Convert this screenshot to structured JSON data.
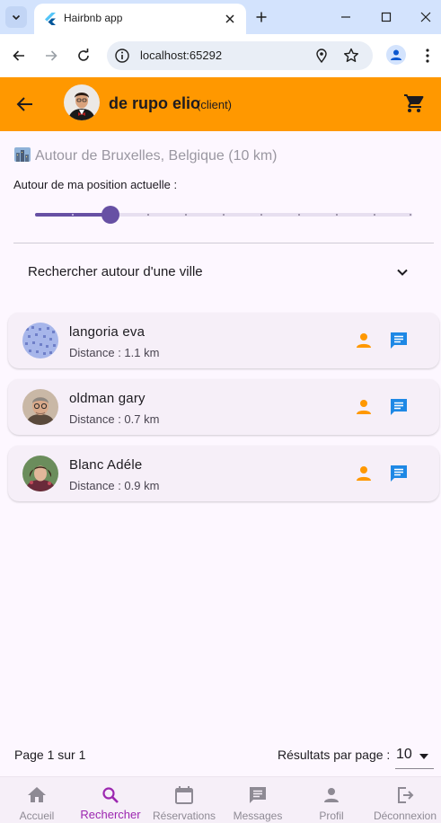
{
  "browser": {
    "tab_title": "Hairbnb app",
    "url": "localhost:65292"
  },
  "appbar": {
    "user_name": "de rupo elio",
    "user_role": "(client)",
    "accent_color": "#ff9800"
  },
  "search": {
    "location_title": "Autour de Bruxelles, Belgique (10 km)",
    "position_label": "Autour de ma position actuelle :",
    "slider_value_fraction": 0.2,
    "slider_divisions": 10,
    "city_search_label": "Rechercher autour d'une ville"
  },
  "results": [
    {
      "name": "langoria eva",
      "distance": "Distance : 1.1 km"
    },
    {
      "name": "oldman gary",
      "distance": "Distance : 0.7 km"
    },
    {
      "name": "Blanc Adéle",
      "distance": "Distance : 0.9 km"
    }
  ],
  "pagination": {
    "page_info": "Page 1 sur 1",
    "per_page_label": "Résultats par page :",
    "per_page_value": "10"
  },
  "bottom_nav": [
    {
      "label": "Accueil",
      "icon": "home-icon"
    },
    {
      "label": "Rechercher",
      "icon": "search-icon",
      "active": true
    },
    {
      "label": "Réservations",
      "icon": "calendar-icon"
    },
    {
      "label": "Messages",
      "icon": "message-icon"
    },
    {
      "label": "Profil",
      "icon": "person-icon"
    },
    {
      "label": "Déconnexion",
      "icon": "logout-icon"
    }
  ]
}
